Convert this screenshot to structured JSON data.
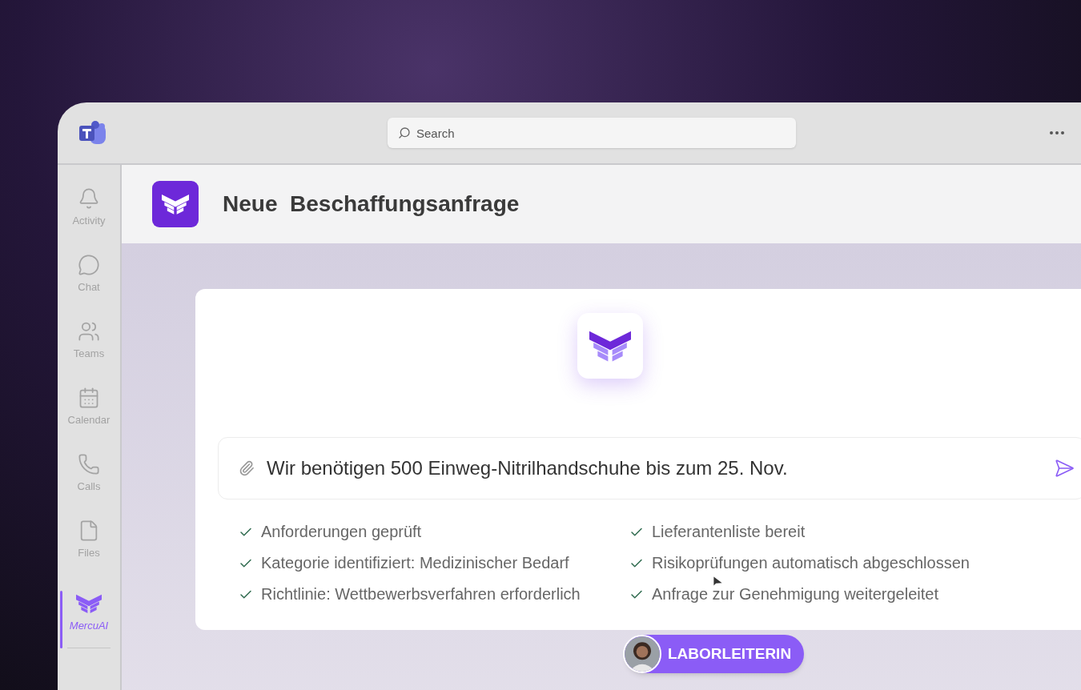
{
  "search": {
    "placeholder": "Search"
  },
  "sidebar": {
    "items": [
      {
        "label": "Activity",
        "selected": false
      },
      {
        "label": "Chat",
        "selected": false
      },
      {
        "label": "Teams",
        "selected": false
      },
      {
        "label": "Calendar",
        "selected": false
      },
      {
        "label": "Calls",
        "selected": false
      },
      {
        "label": "Files",
        "selected": false
      },
      {
        "label": "MercuAI",
        "selected": true
      }
    ]
  },
  "header": {
    "title": "Neue  Beschaffungsanfrage"
  },
  "prompt": {
    "value": "Wir benötigen 500 Einweg-Nitrilhandschuhe bis zum 25. Nov."
  },
  "checklist": [
    {
      "label": "Anforderungen geprüft",
      "checked": true
    },
    {
      "label": "Kategorie identifiziert: Medizinischer Bedarf",
      "checked": true
    },
    {
      "label": "Richtlinie: Wettbewerbsverfahren erforderlich",
      "checked": true
    },
    {
      "label": "Lieferantenliste bereit",
      "checked": true
    },
    {
      "label": "Risikoprüfungen automatisch abgeschlossen",
      "checked": true
    },
    {
      "label": "Anfrage zur Genehmigung weitergeleitet",
      "checked": true
    }
  ],
  "user_badge": {
    "label": "LABORLEITERIN"
  }
}
